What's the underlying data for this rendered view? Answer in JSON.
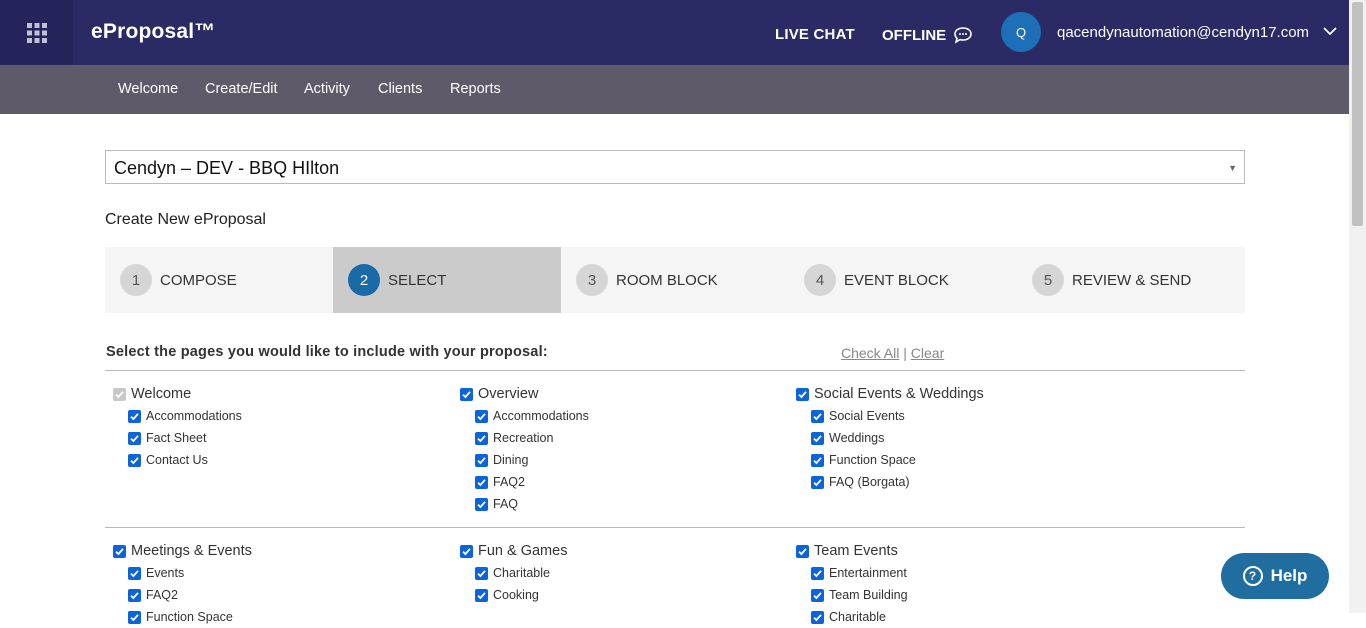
{
  "header": {
    "brand": "eProposal™",
    "live_chat": "LIVE CHAT",
    "offline": "OFFLINE",
    "avatar_initial": "Q",
    "user_email": "qacendynautomation@cendyn17.com"
  },
  "nav": [
    "Welcome",
    "Create/Edit",
    "Activity",
    "Clients",
    "Reports"
  ],
  "property": "Cendyn – DEV - BBQ HIlton",
  "section_title": "Create New eProposal",
  "steps": [
    {
      "num": "1",
      "label": "COMPOSE"
    },
    {
      "num": "2",
      "label": "SELECT"
    },
    {
      "num": "3",
      "label": "ROOM BLOCK"
    },
    {
      "num": "4",
      "label": "EVENT BLOCK"
    },
    {
      "num": "5",
      "label": "REVIEW & SEND"
    }
  ],
  "active_step": 2,
  "pages_prompt": "Select the pages you would like to include with your proposal:",
  "check_all": "Check All",
  "separator": "|",
  "clear": "Clear",
  "groups_row1": [
    {
      "label": "Welcome",
      "disabled": true,
      "children": [
        "Accommodations",
        "Fact Sheet",
        "Contact Us"
      ]
    },
    {
      "label": "Overview",
      "children": [
        "Accommodations",
        "Recreation",
        "Dining",
        "FAQ2",
        "FAQ"
      ]
    },
    {
      "label": "Social Events & Weddings",
      "children": [
        "Social Events",
        "Weddings",
        "Function Space",
        "FAQ (Borgata)"
      ]
    }
  ],
  "groups_row2": [
    {
      "label": "Meetings & Events",
      "children": [
        "Events",
        "FAQ2",
        "Function Space"
      ]
    },
    {
      "label": "Fun & Games",
      "children": [
        "Charitable",
        "Cooking"
      ]
    },
    {
      "label": "Team Events",
      "children": [
        "Entertainment",
        "Team Building",
        "Charitable"
      ]
    }
  ],
  "help": "Help",
  "colors": {
    "header": "#2a2a65",
    "subnav": "#5e5a6a",
    "accent": "#1a6aa8",
    "checkbox": "#0b64d9"
  }
}
